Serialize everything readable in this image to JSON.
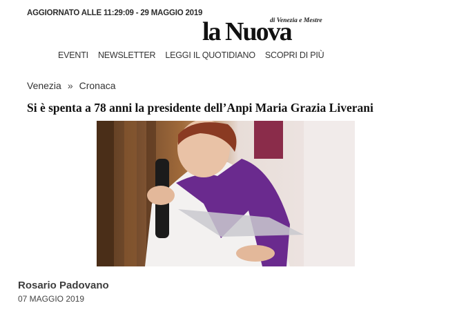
{
  "header": {
    "updated": "AGGIORNATO ALLE 11:29:09 - 29 MAGGIO 2019",
    "logo_sub": "di Venezia e Mestre",
    "logo_main": "la Nuova"
  },
  "nav": [
    "EVENTI",
    "NEWSLETTER",
    "LEGGI IL QUOTIDIANO",
    "SCOPRI DI PIÙ"
  ],
  "breadcrumb": {
    "items": [
      "Venezia",
      "Cronaca"
    ],
    "separator": "»"
  },
  "article": {
    "title": "Si è spenta a 78 anni la presidente dell’Anpi Maria Grazia Liverani",
    "author": "Rosario Padovano",
    "date": "07 MAGGIO 2019"
  },
  "colors": {
    "scarf": "#6a2a8e",
    "accent": "#8a2c4a"
  }
}
